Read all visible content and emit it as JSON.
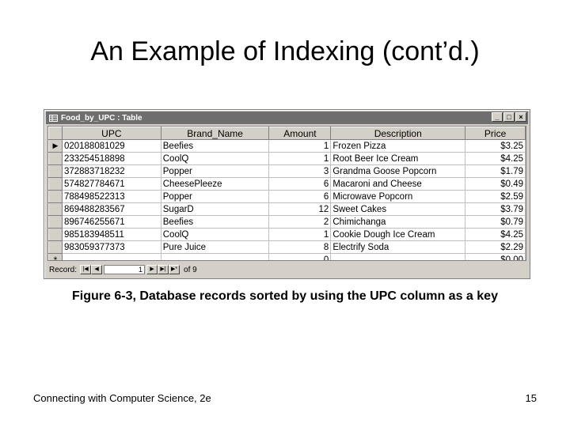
{
  "slide": {
    "title": "An Example of Indexing (cont’d.)",
    "caption": "Figure 6-3, Database records sorted by using the UPC column as a key",
    "footer": "Connecting with Computer Science, 2e",
    "page_number": "15"
  },
  "window": {
    "title": "Food_by_UPC : Table",
    "minimize": "_",
    "maximize": "□",
    "close": "×"
  },
  "table": {
    "columns": [
      "UPC",
      "Brand_Name",
      "Amount",
      "Description",
      "Price"
    ],
    "rows": [
      [
        "020188081029",
        "Beefies",
        "1",
        "Frozen Pizza",
        "$3.25"
      ],
      [
        "233254518898",
        "CoolQ",
        "1",
        "Root Beer Ice Cream",
        "$4.25"
      ],
      [
        "372883718232",
        "Popper",
        "3",
        "Grandma Goose Popcorn",
        "$1.79"
      ],
      [
        "574827784671",
        "CheesePleeze",
        "6",
        "Macaroni and Cheese",
        "$0.49"
      ],
      [
        "788498522313",
        "Popper",
        "6",
        "Microwave Popcorn",
        "$2.59"
      ],
      [
        "869488283567",
        "SugarD",
        "12",
        "Sweet Cakes",
        "$3.79"
      ],
      [
        "896746255671",
        "Beefies",
        "2",
        "Chimichanga",
        "$0.79"
      ],
      [
        "985183948511",
        "CoolQ",
        "1",
        "Cookie Dough Ice Cream",
        "$4.25"
      ],
      [
        "983059377373",
        "Pure Juice",
        "8",
        "Electrify Soda",
        "$2.29"
      ]
    ],
    "new_row": [
      "",
      "",
      "0",
      "",
      "$0.00"
    ],
    "current_marker": "▶",
    "new_marker": "*"
  },
  "navigation": {
    "label": "Record:",
    "current": "1",
    "total_label": "of 9",
    "first": "|◀",
    "prev": "◀",
    "next": "▶",
    "last": "▶|",
    "new": "▶*"
  }
}
